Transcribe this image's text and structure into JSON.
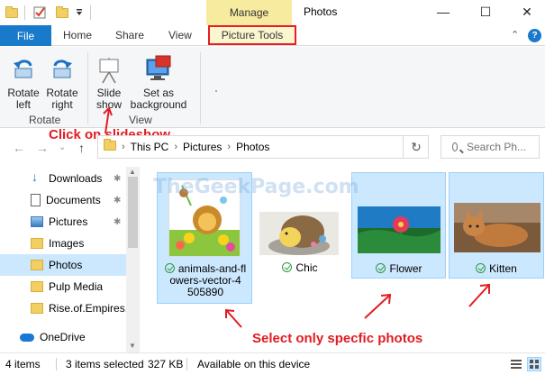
{
  "window": {
    "title": "Photos",
    "context_tab": "Manage",
    "controls": [
      "—",
      "☐",
      "✕"
    ]
  },
  "ribbon_tabs": {
    "file": "File",
    "home": "Home",
    "share": "Share",
    "view": "View",
    "picture_tools": "Picture Tools",
    "collapse": "⌃",
    "help": "?"
  },
  "ribbon": {
    "rotate_left": [
      "Rotate",
      "left"
    ],
    "rotate_right": [
      "Rotate",
      "right"
    ],
    "slide_show": [
      "Slide",
      "show"
    ],
    "set_background": [
      "Set as",
      "background"
    ],
    "group_rotate": "Rotate",
    "group_view": "View"
  },
  "address": {
    "segments": [
      "This PC",
      "Pictures",
      "Photos"
    ],
    "search_placeholder": "Search Ph..."
  },
  "annotations": {
    "click_slideshow": "Click on slideshow",
    "select_photos": "Select only specfic photos",
    "watermark": "TheGeekPage.com"
  },
  "nav": {
    "items": [
      {
        "label": "Downloads",
        "icon": "download-icon",
        "pinned": true
      },
      {
        "label": "Documents",
        "icon": "document-icon",
        "pinned": true
      },
      {
        "label": "Pictures",
        "icon": "pictures-icon",
        "pinned": true
      },
      {
        "label": "Images",
        "icon": "folder-icon",
        "pinned": false
      },
      {
        "label": "Photos",
        "icon": "folder-icon",
        "pinned": false,
        "selected": true
      },
      {
        "label": "Pulp Media",
        "icon": "folder-icon",
        "pinned": false
      },
      {
        "label": "Rise.of.Empires.(",
        "icon": "folder-icon",
        "pinned": false
      },
      {
        "label": "OneDrive",
        "icon": "onedrive-icon",
        "pinned": false
      }
    ]
  },
  "files": [
    {
      "name_lines": [
        "animals-and-fl",
        "owers-vector-4",
        "505890"
      ],
      "selected": true
    },
    {
      "name_lines": [
        "Chic"
      ],
      "selected": false
    },
    {
      "name_lines": [
        "Flower"
      ],
      "selected": true
    },
    {
      "name_lines": [
        "Kitten"
      ],
      "selected": true
    }
  ],
  "status": {
    "count": "4 items",
    "selected": "3 items selected",
    "size": "327 KB",
    "availability": "Available on this device"
  },
  "colors": {
    "accent": "#1979ca",
    "selection": "#cce8ff",
    "annotation": "#e21c22",
    "manage_tab": "#f7eba0"
  }
}
